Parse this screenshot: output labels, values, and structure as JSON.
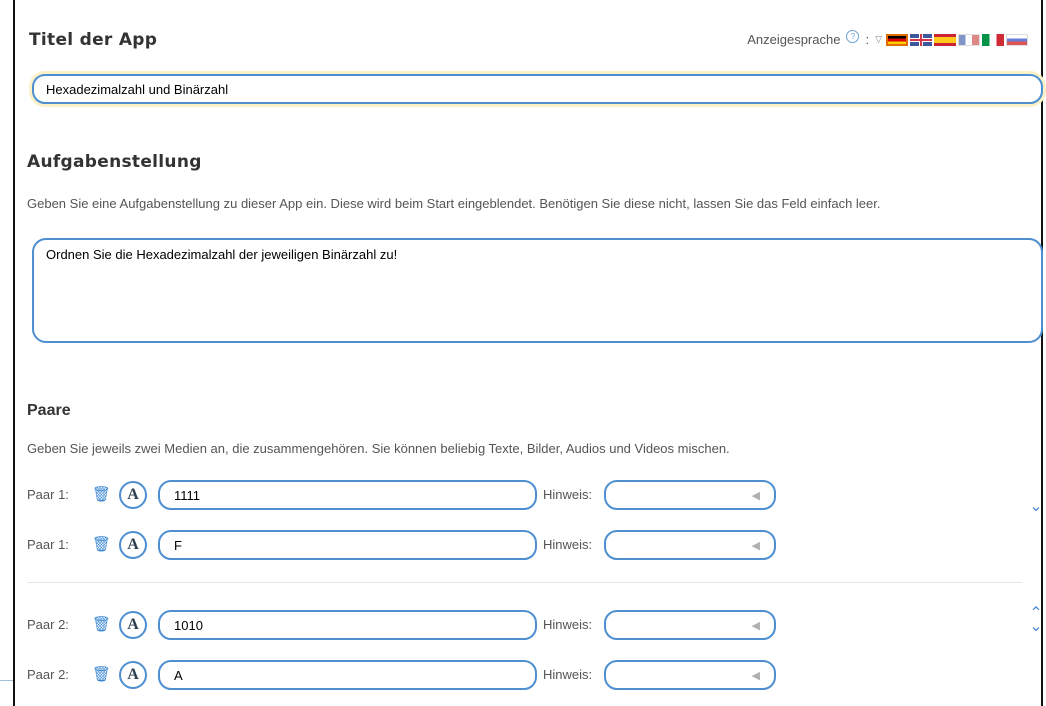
{
  "header": {
    "title": "Titel der App",
    "display_language_label": "Anzeigesprache",
    "help_glyph": "?",
    "colon": ":",
    "flags": [
      "de",
      "gb",
      "es",
      "fr",
      "it",
      "ru"
    ]
  },
  "title_field": {
    "value": "Hexadezimalzahl und Binärzahl"
  },
  "task": {
    "heading": "Aufgabenstellung",
    "description": "Geben Sie eine Aufgabenstellung zu dieser App ein. Diese wird beim Start eingeblendet. Benötigen Sie diese nicht, lassen Sie das Feld einfach leer.",
    "value": "Ordnen Sie die Hexadezimalzahl der jeweiligen Binärzahl zu!"
  },
  "pairs": {
    "heading": "Paare",
    "description": "Geben Sie jeweils zwei Medien an, die zusammengehören. Sie können beliebig Texte, Bilder, Audios und Videos mischen.",
    "hint_label": "Hinweis:",
    "text_glyph": "A",
    "trash_glyph": "🗑",
    "speaker_glyph": "◀",
    "chevron_down": "⌄",
    "chevron_up": "⌃",
    "rows": [
      {
        "label": "Paar 1:",
        "value": "1111",
        "hint": ""
      },
      {
        "label": "Paar 1:",
        "value": "F",
        "hint": ""
      },
      {
        "label": "Paar 2:",
        "value": "1010",
        "hint": ""
      },
      {
        "label": "Paar 2:",
        "value": "A",
        "hint": ""
      }
    ]
  },
  "colors": {
    "accent": "#4d8fd1",
    "title_glow": "#fbf1c9"
  }
}
